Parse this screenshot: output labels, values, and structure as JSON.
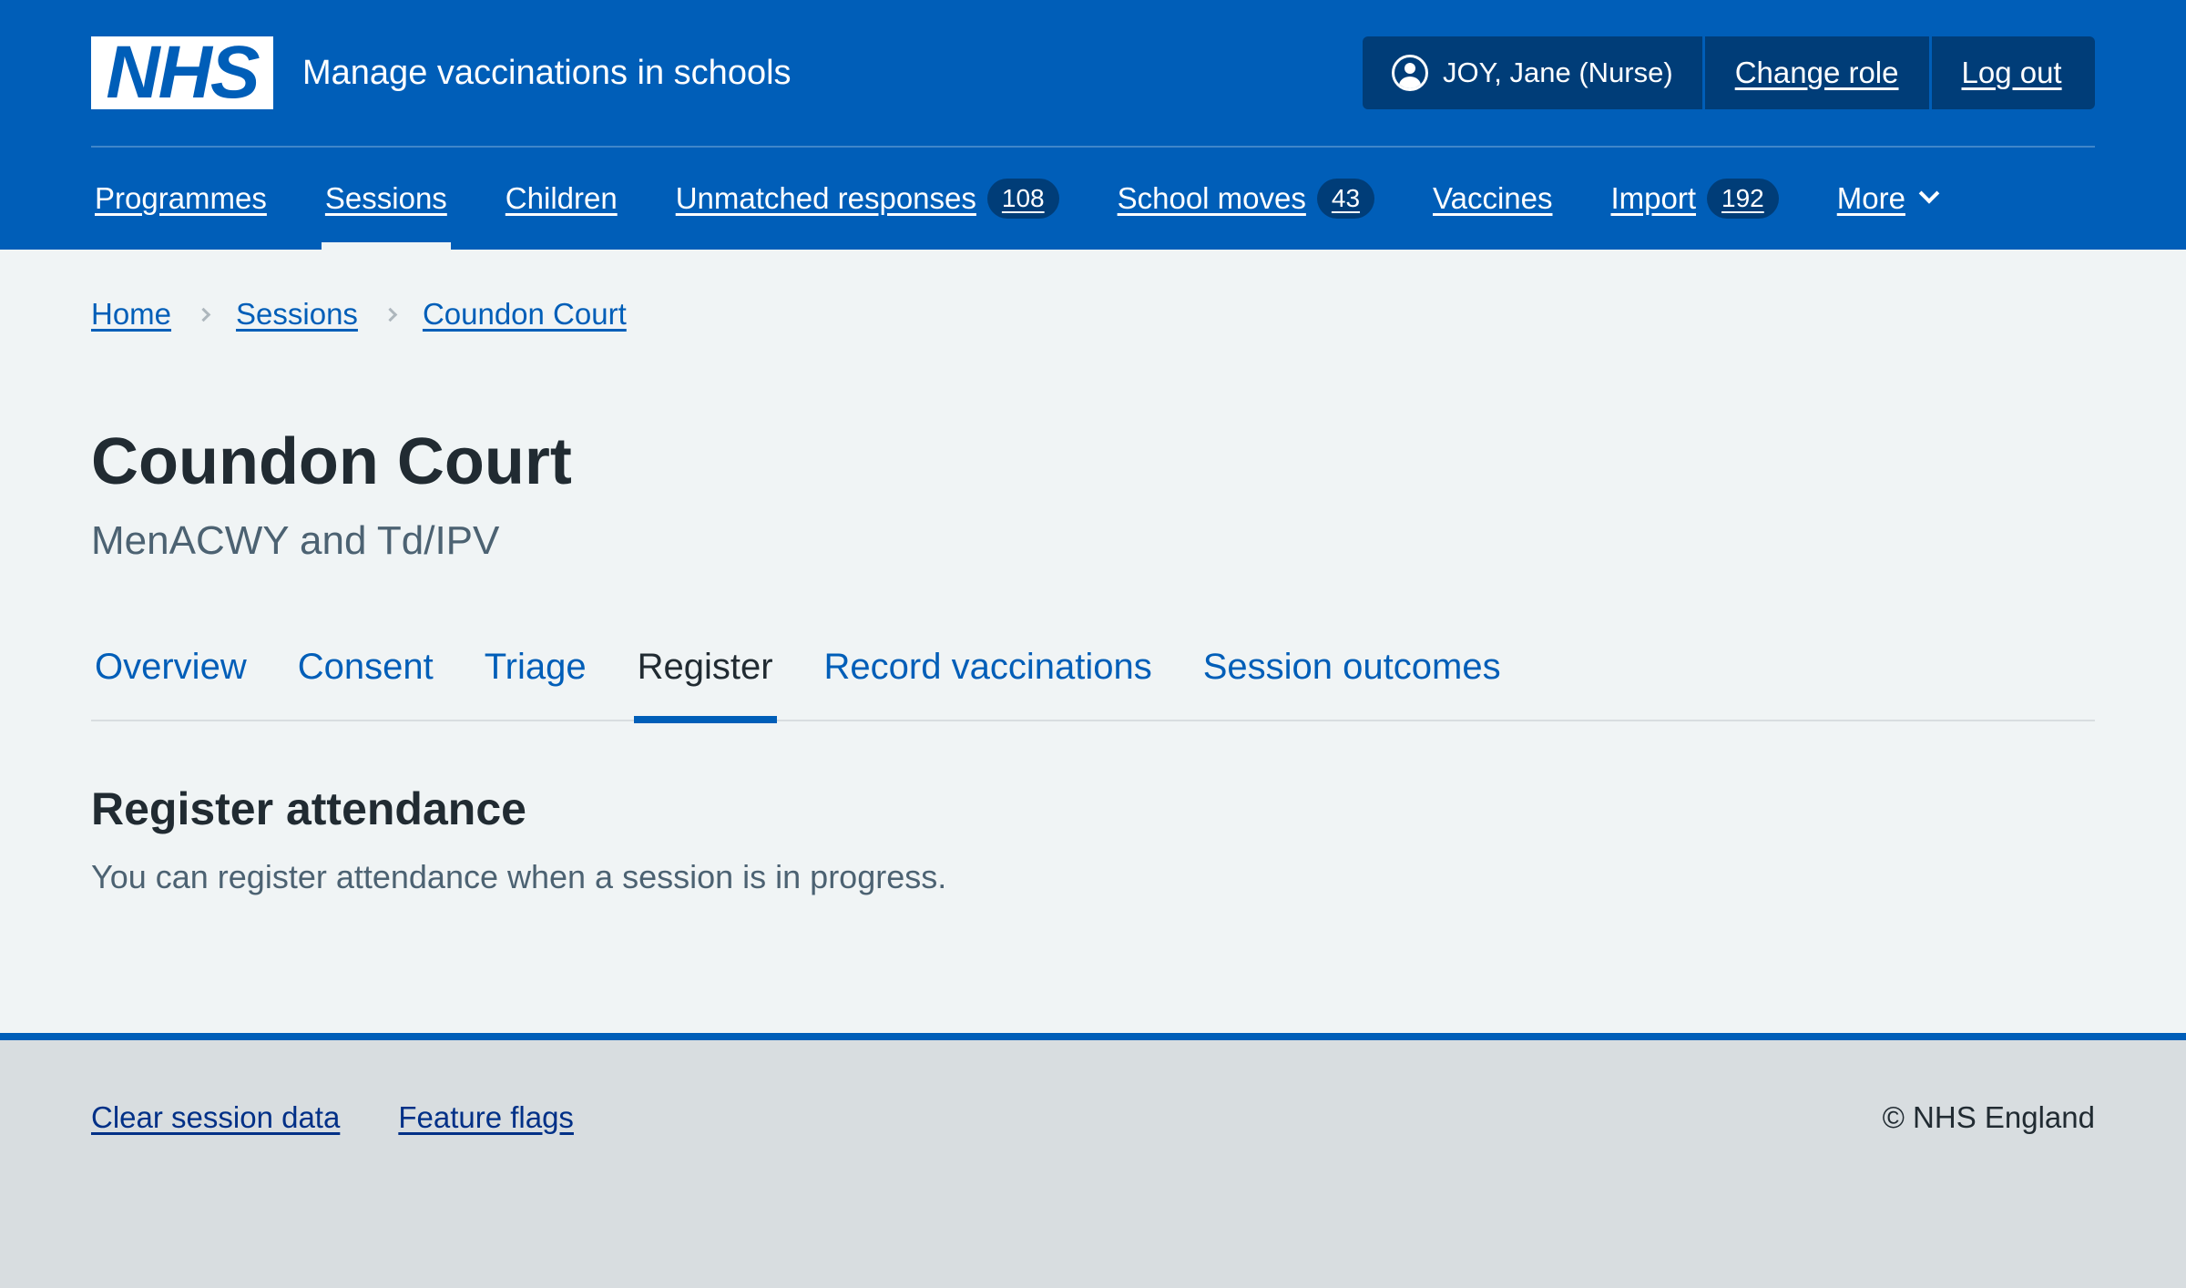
{
  "header": {
    "logo_text": "NHS",
    "service_name": "Manage vaccinations in schools",
    "user_name": "JOY, Jane (Nurse)",
    "change_role_label": "Change role",
    "log_out_label": "Log out",
    "user_icon": "user-circle-icon"
  },
  "nav": {
    "items": [
      {
        "label": "Programmes"
      },
      {
        "label": "Sessions",
        "active": true
      },
      {
        "label": "Children"
      },
      {
        "label": "Unmatched responses",
        "count": "108"
      },
      {
        "label": "School moves",
        "count": "43"
      },
      {
        "label": "Vaccines"
      },
      {
        "label": "Import",
        "count": "192"
      },
      {
        "label": "More",
        "icon": "chevron-down-icon"
      }
    ]
  },
  "breadcrumb": [
    "Home",
    "Sessions",
    "Coundon Court"
  ],
  "page": {
    "title": "Coundon Court",
    "caption": "MenACWY and Td/IPV"
  },
  "tabs": [
    {
      "label": "Overview"
    },
    {
      "label": "Consent"
    },
    {
      "label": "Triage"
    },
    {
      "label": "Register",
      "active": true
    },
    {
      "label": "Record vaccinations"
    },
    {
      "label": "Session outcomes"
    }
  ],
  "content": {
    "heading": "Register attendance",
    "body": "You can register attendance when a session is in progress."
  },
  "footer": {
    "links": [
      "Clear session data",
      "Feature flags"
    ],
    "copyright": "© NHS England"
  },
  "colors": {
    "brand_blue": "#005eb8",
    "dark_blue": "#003d78",
    "page_background": "#f0f4f5",
    "footer_background": "#d8dde0"
  }
}
